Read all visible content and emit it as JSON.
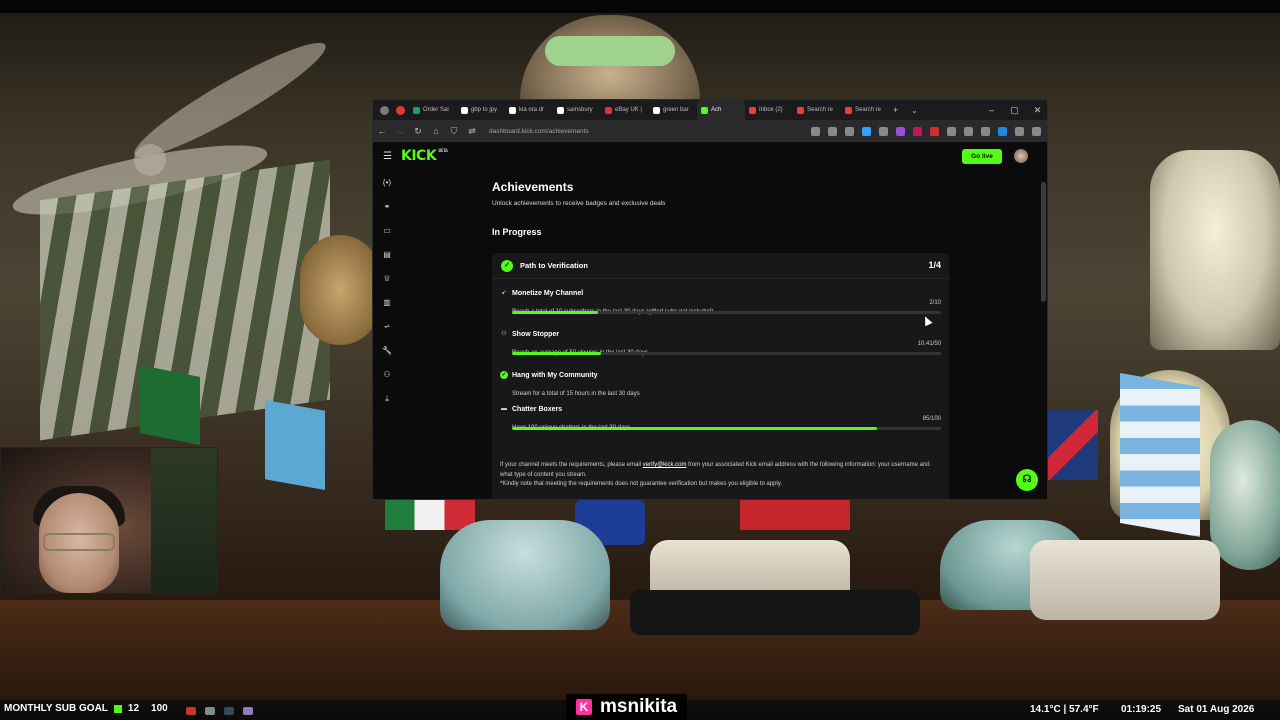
{
  "browser": {
    "tabs": [
      {
        "label": "Order Sai",
        "color": "#1aa260"
      },
      {
        "label": "gbp to jpy",
        "color": "#ffffff"
      },
      {
        "label": "kia ora dr",
        "color": "#ffffff"
      },
      {
        "label": "sainsbury",
        "color": "#ffffff"
      },
      {
        "label": "eBay UK |",
        "color": "#e53238"
      },
      {
        "label": "green bar",
        "color": "#ffffff"
      },
      {
        "label": "Ach",
        "color": "#53fc18",
        "active": true
      },
      {
        "label": "Inbox (2)",
        "color": "#ea4335"
      },
      {
        "label": "Search re",
        "color": "#ea4335"
      },
      {
        "label": "Search re",
        "color": "#ea4335"
      }
    ],
    "new_tab": "+",
    "tab_list": "⌄",
    "minimize": "–",
    "maximize": "▢",
    "close": "✕",
    "url": "dashboard.kick.com/achievements"
  },
  "kick": {
    "logo": "KICK",
    "logo_sup": "BETA",
    "go_live": "Go live",
    "accent": "#53fc18"
  },
  "sidebar": {
    "items": [
      {
        "icon": "broadcast-icon",
        "glyph": "(•)"
      },
      {
        "icon": "link-icon",
        "glyph": "⚭"
      },
      {
        "icon": "calendar-icon",
        "glyph": "▭"
      },
      {
        "icon": "chart-icon",
        "glyph": "▤"
      },
      {
        "icon": "trophy-icon",
        "glyph": "♕"
      },
      {
        "icon": "card-icon",
        "glyph": "▥"
      },
      {
        "icon": "analytics-icon",
        "glyph": "⩫"
      },
      {
        "icon": "wrench-icon",
        "glyph": "🔧"
      },
      {
        "icon": "users-icon",
        "glyph": "⚇"
      },
      {
        "icon": "download-icon",
        "glyph": "⤓"
      }
    ]
  },
  "page": {
    "title": "Achievements",
    "subtitle": "Unlock achievements to receive badges and exclusive deals",
    "section": "In Progress"
  },
  "card": {
    "title": "Path to Verification",
    "count": "1/4",
    "achievements": [
      {
        "name": "Monetize My Channel",
        "desc": "Reach a total of 10 subscribers in the last 30 days (gifted subs not included)",
        "progress": "2/10",
        "fraction": 0.2,
        "icon": "arrow-icon",
        "glyph": "➹",
        "done": false
      },
      {
        "name": "Show Stopper",
        "desc": "Reach an average of 50 viewers in the last 30 days",
        "progress": "10.41/50",
        "fraction": 0.208,
        "icon": "viewers-icon",
        "glyph": "⚇",
        "done": false
      },
      {
        "name": "Hang with My Community",
        "desc": "Stream for a total of 15 hours in the last 30 days",
        "progress": "",
        "fraction": 1,
        "icon": "check-icon",
        "glyph": "✓",
        "done": true
      },
      {
        "name": "Chatter Boxers",
        "desc": "Have 100 unique chatters in the last 30 days",
        "progress": "85/100",
        "fraction": 0.85,
        "icon": "chat-icon",
        "glyph": "▬",
        "done": false
      }
    ],
    "note_pre": "If your channel meets the requirements, please email ",
    "note_link": "verify@kick.com",
    "note_post": " from your associated Kick email address with the following information: your username and what type of content you stream.",
    "note_disclaimer": "*Kindly note that meeting the requirements does not guarantee verification but makes you eligible to apply."
  },
  "overlay": {
    "sub_goal_label": "MONTHLY SUB GOAL",
    "sub_goal_current": "12",
    "sub_goal_target": "100",
    "streamer_name": "msnikita",
    "streamer_logo": "K",
    "weather": "14.1°C | 57.4°F",
    "time": "01:19:25",
    "date": "Sat 01 Aug 2026"
  }
}
